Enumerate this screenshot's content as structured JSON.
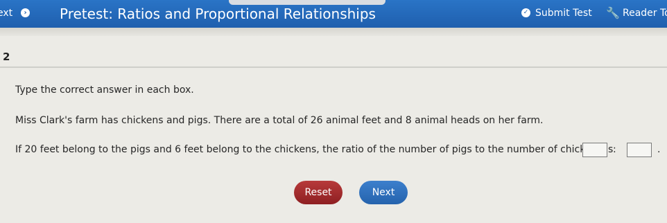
{
  "header": {
    "next_label": "ext",
    "title": "Pretest: Ratios and Proportional Relationships",
    "submit_label": "Submit Test",
    "reader_label": "Reader To"
  },
  "question": {
    "number": "2",
    "instruction": "Type the correct answer in each box.",
    "context": "Miss Clark's farm has chickens and pigs. There are a total of 26 animal feet and 8 animal heads on her farm.",
    "prompt": "If 20 feet belong to the pigs and 6 feet belong to the chickens, the ratio of the number of pigs to the number of chickens is",
    "separator": ":",
    "end_punct": "."
  },
  "buttons": {
    "reset_label": "Reset",
    "next_label": "Next"
  },
  "colors": {
    "header_blue": "#1f5fae",
    "reset_red": "#8e1f22",
    "next_blue": "#2563ad"
  }
}
